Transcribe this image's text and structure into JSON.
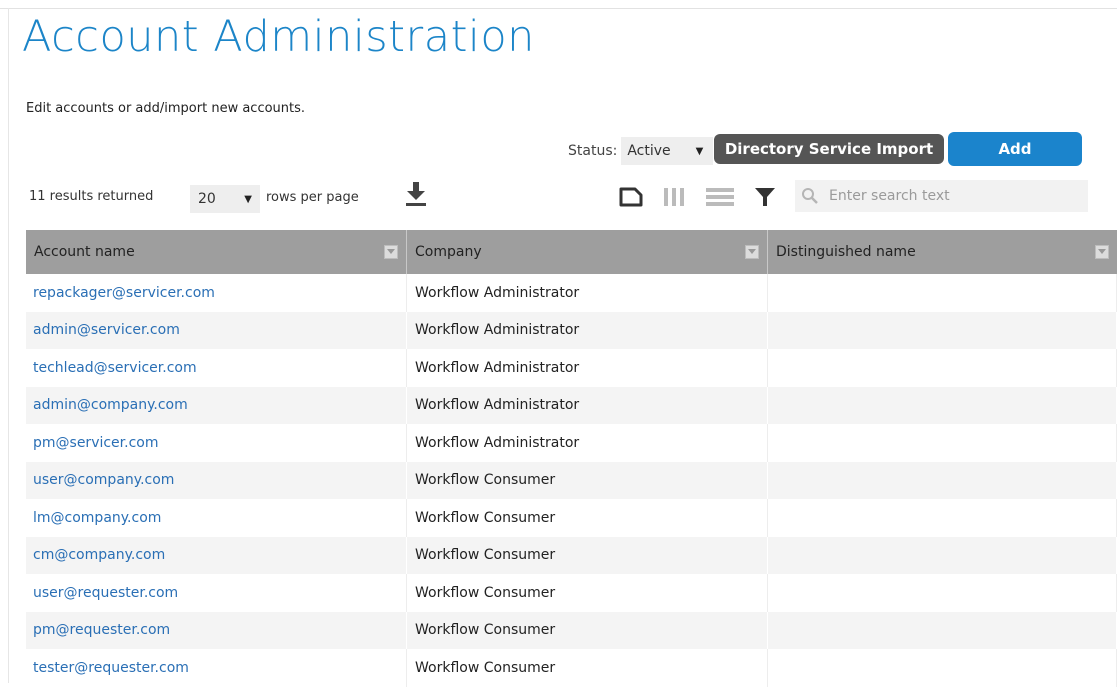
{
  "page": {
    "title": "Account Administration",
    "subtitle": "Edit accounts or add/import new accounts."
  },
  "toolbar": {
    "status_label": "Status:",
    "status_value": "Active",
    "directory_import_label": "Directory Service Import",
    "add_label": "Add"
  },
  "list_controls": {
    "results_text": "11 results returned",
    "rows_per_page_value": "20",
    "rows_per_page_label": "rows per page",
    "search_placeholder": "Enter search text"
  },
  "icons": {
    "download": "download-icon",
    "page": "page-icon",
    "columns": "columns-icon",
    "rows": "rows-icon",
    "filter": "filter-icon",
    "search": "search-icon"
  },
  "colors": {
    "title": "#1c85c8",
    "add_button": "#1b84cc",
    "directory_button": "#555555",
    "header_bg": "#9e9e9e",
    "link": "#2a6fb5"
  },
  "table": {
    "columns": [
      "Account name",
      "Company",
      "Distinguished name"
    ],
    "rows": [
      {
        "account": "repackager@servicer.com",
        "company": "Workflow Administrator",
        "dn": ""
      },
      {
        "account": "admin@servicer.com",
        "company": "Workflow Administrator",
        "dn": ""
      },
      {
        "account": "techlead@servicer.com",
        "company": "Workflow Administrator",
        "dn": ""
      },
      {
        "account": "admin@company.com",
        "company": "Workflow Administrator",
        "dn": ""
      },
      {
        "account": "pm@servicer.com",
        "company": "Workflow Administrator",
        "dn": ""
      },
      {
        "account": "user@company.com",
        "company": "Workflow Consumer",
        "dn": ""
      },
      {
        "account": "lm@company.com",
        "company": "Workflow Consumer",
        "dn": ""
      },
      {
        "account": "cm@company.com",
        "company": "Workflow Consumer",
        "dn": ""
      },
      {
        "account": "user@requester.com",
        "company": "Workflow Consumer",
        "dn": ""
      },
      {
        "account": "pm@requester.com",
        "company": "Workflow Consumer",
        "dn": ""
      },
      {
        "account": "tester@requester.com",
        "company": "Workflow Consumer",
        "dn": ""
      }
    ]
  }
}
